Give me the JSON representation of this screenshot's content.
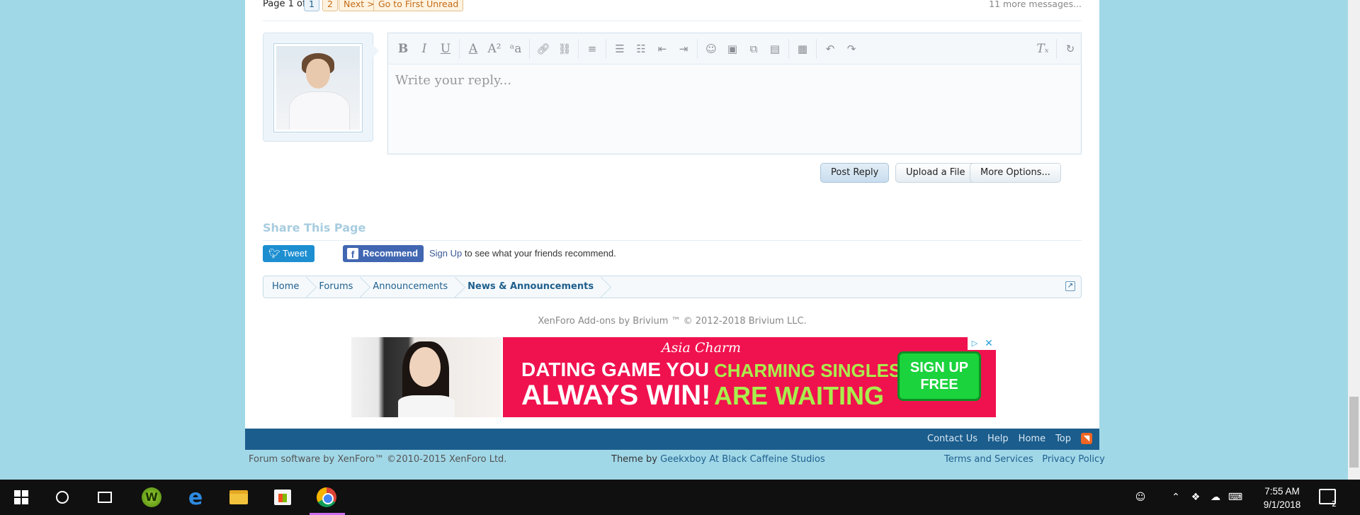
{
  "pagination": {
    "label": "Page 1 of 2",
    "pages": [
      "1",
      "2"
    ],
    "next": "Next >",
    "first_unread": "Go to First Unread",
    "more_messages": "11 more messages..."
  },
  "editor": {
    "placeholder": "Write your reply...",
    "toolbar": {
      "bold": "B",
      "italic": "I",
      "underline": "U",
      "font_color": "A",
      "font_size": "A²",
      "font_family": "ᵃa"
    }
  },
  "actions": {
    "post_reply": "Post Reply",
    "upload_file": "Upload a File",
    "more_options": "More Options..."
  },
  "share": {
    "title": "Share This Page",
    "tweet": "Tweet",
    "recommend": "Recommend",
    "sign_up": "Sign Up",
    "sign_up_suffix": "to see what your friends recommend."
  },
  "breadcrumb": [
    "Home",
    "Forums",
    "Announcements",
    "News & Announcements"
  ],
  "copyright": "XenForo Add-ons by Brivium ™ © 2012-2018 Brivium LLC.",
  "ad": {
    "brand": "Asia Charm",
    "line1": "DATING GAME YOU",
    "line2": "ALWAYS WIN!",
    "green1": "CHARMING SINGLES",
    "green2": "ARE WAITING",
    "cta_line1": "SIGN UP",
    "cta_line2": "FREE"
  },
  "footer": {
    "links": [
      "Contact Us",
      "Help",
      "Home",
      "Top"
    ],
    "software": "Forum software by XenForo™ ©2010-2015 XenForo Ltd.",
    "theme_prefix": "Theme by",
    "theme_author": "Geekxboy At Black Caffeine Studios",
    "terms": "Terms and Services",
    "privacy": "Privacy Policy"
  },
  "taskbar": {
    "time": "7:55 AM",
    "date": "9/1/2018",
    "notification_count": "2",
    "apps": [
      "windows-start",
      "cortana",
      "task-view",
      "w-app",
      "edge",
      "file-explorer",
      "store",
      "chrome"
    ]
  },
  "colors": {
    "background": "#a1d8e8",
    "footer_bar": "#1b5d8c",
    "ad_red": "#f0124f",
    "ad_green": "#1bd33c"
  }
}
